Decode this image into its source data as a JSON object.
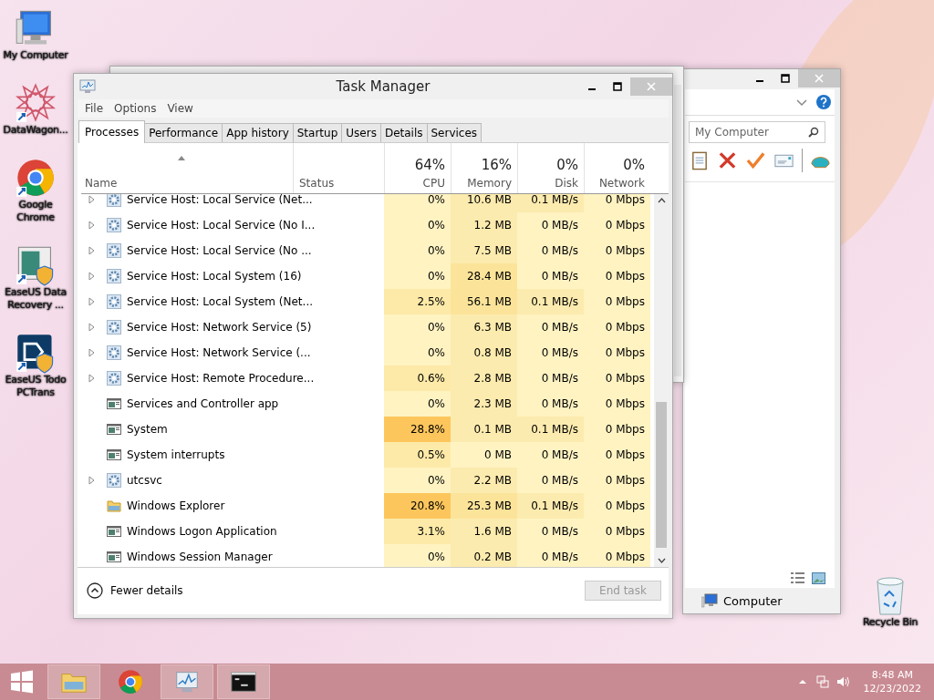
{
  "desktop_icons": [
    {
      "label": "My Computer",
      "kind": "computer",
      "shortcut": false
    },
    {
      "label": "DataWagon...",
      "kind": "star",
      "shortcut": true
    },
    {
      "label": "Google Chrome",
      "kind": "chrome",
      "shortcut": true
    },
    {
      "label": "EaseUS Data Recovery ...",
      "kind": "recovery",
      "shortcut": true
    },
    {
      "label": "EaseUS Todo PCTrans",
      "kind": "pctrans",
      "shortcut": true
    }
  ],
  "recycle_bin": {
    "label": "Recycle Bin"
  },
  "back_window": {
    "search": "My Computer",
    "status": "Computer"
  },
  "task_manager": {
    "title": "Task Manager",
    "menu": [
      "File",
      "Options",
      "View"
    ],
    "tabs": [
      {
        "label": "Processes",
        "selected": true
      },
      {
        "label": "Performance",
        "selected": false
      },
      {
        "label": "App history",
        "selected": false
      },
      {
        "label": "Startup",
        "selected": false
      },
      {
        "label": "Users",
        "selected": false
      },
      {
        "label": "Details",
        "selected": false
      },
      {
        "label": "Services",
        "selected": false
      }
    ],
    "columns": [
      {
        "label": "Name"
      },
      {
        "label": "Status"
      },
      {
        "percent": "64%",
        "label": "CPU"
      },
      {
        "percent": "16%",
        "label": "Memory"
      },
      {
        "percent": "0%",
        "label": "Disk"
      },
      {
        "percent": "0%",
        "label": "Network"
      }
    ],
    "rows": [
      {
        "name": "Service Host: Local Service (Net...",
        "kind": "service",
        "expandable": true,
        "cpu": "0%",
        "memory": "10.6 MB",
        "disk": "0.1 MB/s",
        "network": "0 Mbps"
      },
      {
        "name": "Service Host: Local Service (No I...",
        "kind": "service",
        "expandable": true,
        "cpu": "0%",
        "memory": "1.2 MB",
        "disk": "0 MB/s",
        "network": "0 Mbps"
      },
      {
        "name": "Service Host: Local Service (No ...",
        "kind": "service",
        "expandable": true,
        "cpu": "0%",
        "memory": "7.5 MB",
        "disk": "0 MB/s",
        "network": "0 Mbps"
      },
      {
        "name": "Service Host: Local System (16)",
        "kind": "service",
        "expandable": true,
        "cpu": "0%",
        "memory": "28.4 MB",
        "disk": "0 MB/s",
        "network": "0 Mbps"
      },
      {
        "name": "Service Host: Local System (Net...",
        "kind": "service",
        "expandable": true,
        "cpu": "2.5%",
        "memory": "56.1 MB",
        "disk": "0.1 MB/s",
        "network": "0 Mbps"
      },
      {
        "name": "Service Host: Network Service (5)",
        "kind": "service",
        "expandable": true,
        "cpu": "0%",
        "memory": "6.3 MB",
        "disk": "0 MB/s",
        "network": "0 Mbps"
      },
      {
        "name": "Service Host: Network Service (...",
        "kind": "service",
        "expandable": true,
        "cpu": "0%",
        "memory": "0.8 MB",
        "disk": "0 MB/s",
        "network": "0 Mbps"
      },
      {
        "name": "Service Host: Remote Procedure...",
        "kind": "service",
        "expandable": true,
        "cpu": "0.6%",
        "memory": "2.8 MB",
        "disk": "0 MB/s",
        "network": "0 Mbps"
      },
      {
        "name": "Services and Controller app",
        "kind": "app",
        "expandable": false,
        "cpu": "0%",
        "memory": "2.3 MB",
        "disk": "0 MB/s",
        "network": "0 Mbps"
      },
      {
        "name": "System",
        "kind": "app",
        "expandable": false,
        "cpu": "28.8%",
        "memory": "0.1 MB",
        "disk": "0.1 MB/s",
        "network": "0 Mbps"
      },
      {
        "name": "System interrupts",
        "kind": "app",
        "expandable": false,
        "cpu": "0.5%",
        "memory": "0 MB",
        "disk": "0 MB/s",
        "network": "0 Mbps"
      },
      {
        "name": "utcsvc",
        "kind": "service",
        "expandable": true,
        "cpu": "0%",
        "memory": "2.2 MB",
        "disk": "0 MB/s",
        "network": "0 Mbps"
      },
      {
        "name": "Windows Explorer",
        "kind": "folder",
        "expandable": false,
        "cpu": "20.8%",
        "memory": "25.3 MB",
        "disk": "0.1 MB/s",
        "network": "0 Mbps"
      },
      {
        "name": "Windows Logon Application",
        "kind": "app",
        "expandable": false,
        "cpu": "3.1%",
        "memory": "1.6 MB",
        "disk": "0 MB/s",
        "network": "0 Mbps"
      },
      {
        "name": "Windows Session Manager",
        "kind": "app",
        "expandable": false,
        "cpu": "0%",
        "memory": "0.2 MB",
        "disk": "0 MB/s",
        "network": "0 Mbps"
      }
    ],
    "fewer_details": "Fewer details",
    "end_task": {
      "label": "End task",
      "disabled": true
    }
  },
  "taskbar": {
    "apps": [
      {
        "kind": "explorer",
        "running": true
      },
      {
        "kind": "chrome",
        "running": false
      },
      {
        "kind": "taskmgr",
        "running": true
      },
      {
        "kind": "cmd",
        "running": true
      }
    ],
    "time": "8:48 AM",
    "date": "12/23/2022"
  }
}
